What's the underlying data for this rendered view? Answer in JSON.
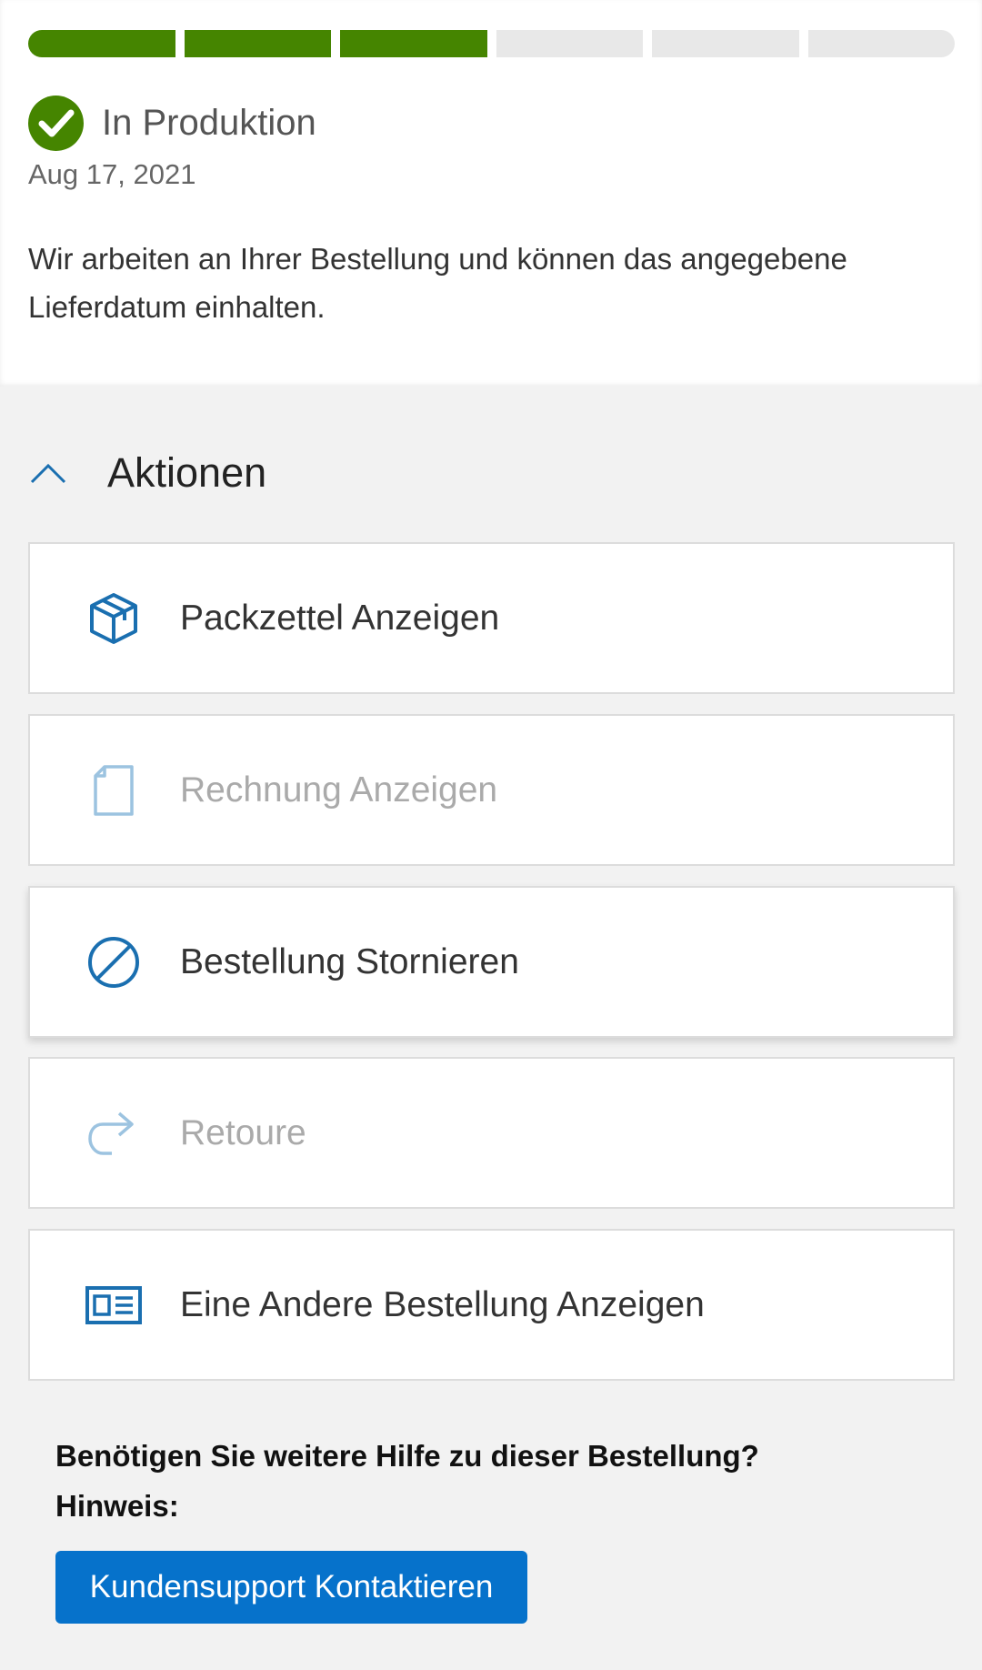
{
  "progress": {
    "total_steps": 6,
    "completed_steps": 3,
    "color_done": "#458500",
    "color_pending": "#e8e8e8"
  },
  "status": {
    "icon": "check-circle-icon",
    "title": "In Produktion",
    "date": "Aug 17, 2021",
    "description": "Wir arbeiten an Ihrer Bestellung und können das angegebene Lieferdatum einhalten."
  },
  "actions": {
    "title": "Aktionen",
    "toggle_icon": "chevron-up-icon",
    "items": [
      {
        "label": "Packzettel Anzeigen",
        "icon": "package-box-icon",
        "enabled": true
      },
      {
        "label": "Rechnung Anzeigen",
        "icon": "document-icon",
        "enabled": false
      },
      {
        "label": "Bestellung Stornieren",
        "icon": "cancel-icon",
        "enabled": true
      },
      {
        "label": "Retoure",
        "icon": "return-arrow-icon",
        "enabled": false
      },
      {
        "label": "Eine Andere Bestellung Anzeigen",
        "icon": "order-list-icon",
        "enabled": true
      }
    ]
  },
  "help": {
    "question": "Benötigen Sie weitere Hilfe zu dieser Bestellung?",
    "note": "Hinweis:",
    "button_label": "Kundensupport Kontaktieren"
  },
  "colors": {
    "accent": "#0672cb",
    "icon_blue": "#1a6fb0",
    "icon_disabled": "#9cc3e0"
  }
}
